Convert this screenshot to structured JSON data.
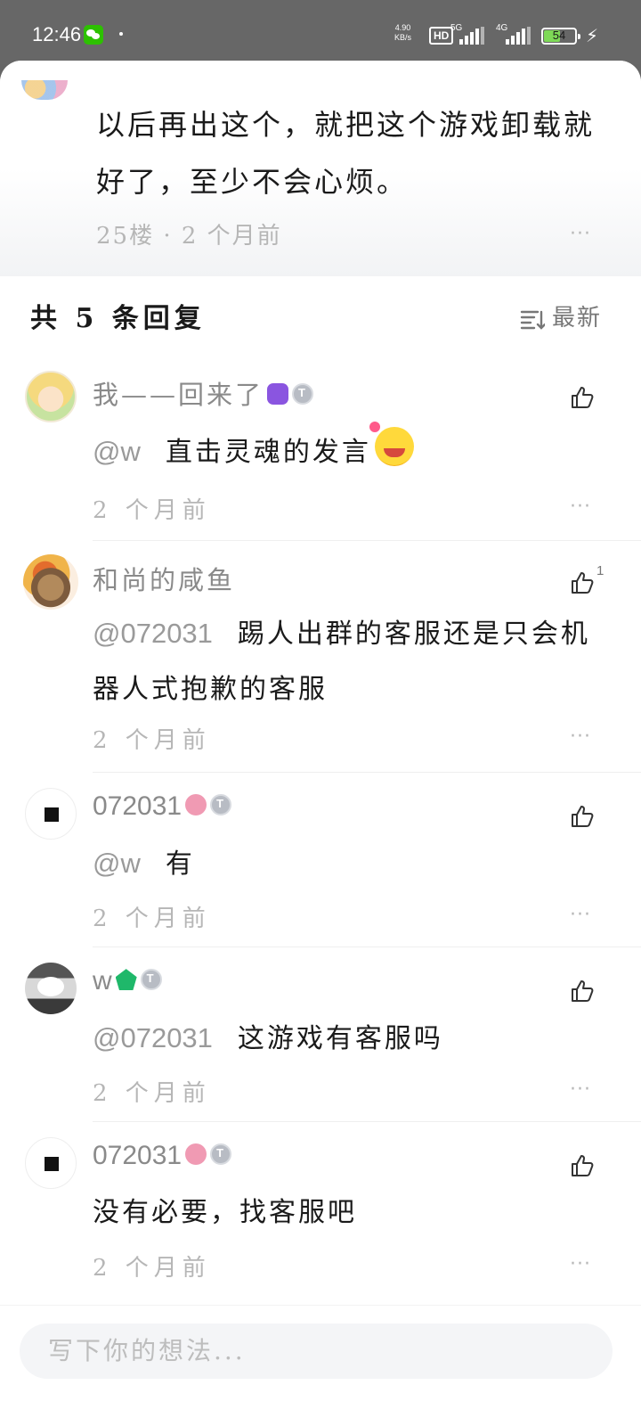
{
  "status_bar": {
    "time": "12:46",
    "speed_value": "4.90",
    "speed_unit": "KB/s",
    "hd": "HD",
    "net1": "5G",
    "net2": "4G",
    "battery": "54",
    "battery_level_percent": 54
  },
  "parent_comment": {
    "text": "以后再出这个，就把这个游戏卸载就好了，至少不会心烦。",
    "meta": "25楼 · 2 个月前",
    "more": "···"
  },
  "replies_header": {
    "title": "共 5 条回复",
    "sort_label": "最新"
  },
  "replies": [
    {
      "username": "我——回来了",
      "mention": "@w",
      "text": "直击灵魂的发言",
      "time": "2 个月前",
      "like_count": "",
      "more": "···"
    },
    {
      "username": "和尚的咸鱼",
      "mention": "@072031",
      "text": "踢人出群的客服还是只会机器人式抱歉的客服",
      "time": "2 个月前",
      "like_count": "1",
      "more": "···"
    },
    {
      "username": "072031",
      "mention": "@w",
      "text": "有",
      "time": "2 个月前",
      "like_count": "",
      "more": "···"
    },
    {
      "username": "w",
      "mention": "@072031",
      "text": "这游戏有客服吗",
      "time": "2 个月前",
      "like_count": "",
      "more": "···"
    },
    {
      "username": "072031",
      "mention": "",
      "text": "没有必要，找客服吧",
      "time": "2 个月前",
      "like_count": "",
      "more": "···"
    }
  ],
  "input": {
    "placeholder": "写下你的想法..."
  }
}
